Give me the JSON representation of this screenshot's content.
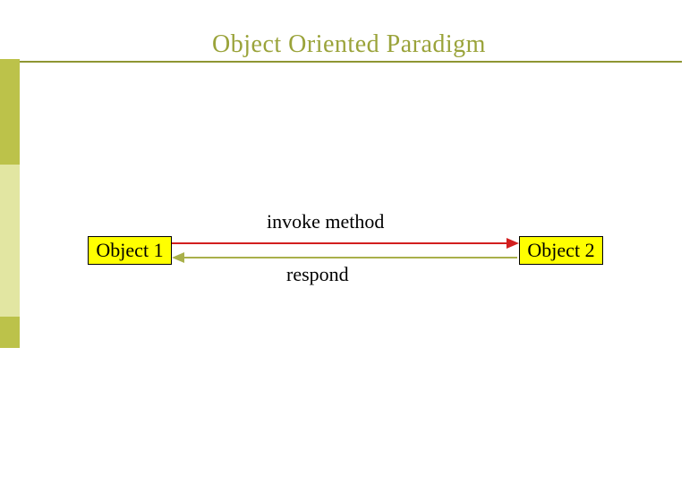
{
  "title": "Object Oriented Paradigm",
  "diagram": {
    "object1_label": "Object 1",
    "object2_label": "Object 2",
    "invoke_label": "invoke method",
    "respond_label": "respond"
  },
  "colors": {
    "title": "#9aa33a",
    "rule": "#8e9632",
    "sidebar_dark": "#bcc24a",
    "sidebar_light": "#e2e6a2",
    "box_fill": "#ffff00",
    "invoke_arrow": "#d21f1f",
    "respond_arrow": "#a9b04a"
  }
}
